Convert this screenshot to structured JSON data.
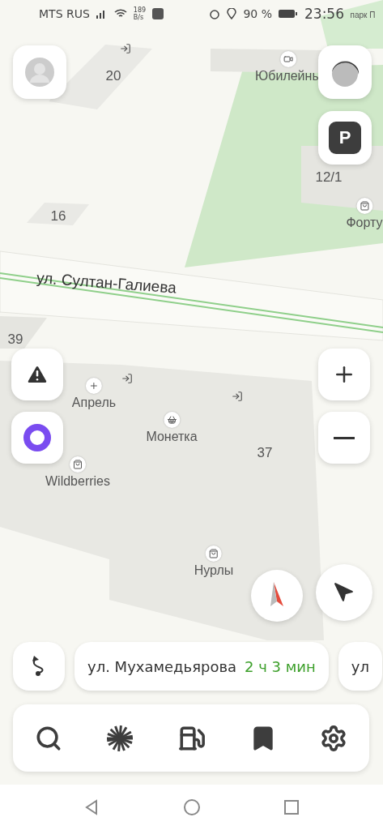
{
  "status_bar": {
    "carrier": "MTS RUS",
    "speed_value": "189",
    "speed_unit": "B/s",
    "battery": "90 %",
    "time": "23:56"
  },
  "map": {
    "street": "ул. Султан-Галиева",
    "labels": [
      {
        "kind": "number",
        "text": "20"
      },
      {
        "kind": "number",
        "text": "16"
      },
      {
        "kind": "number",
        "text": "12/1"
      },
      {
        "kind": "number",
        "text": "39"
      },
      {
        "kind": "number",
        "text": "37"
      },
      {
        "kind": "poi",
        "text": "Юбилейны"
      },
      {
        "kind": "poi",
        "text": "Форту"
      },
      {
        "kind": "poi",
        "text": "Апрель"
      },
      {
        "kind": "poi",
        "text": "Монетка"
      },
      {
        "kind": "poi",
        "text": "Wildberries"
      },
      {
        "kind": "poi",
        "text": "Нурлы"
      },
      {
        "kind": "small",
        "text": "парк П"
      }
    ]
  },
  "parking_button": {
    "label": "P"
  },
  "route_chips": [
    {
      "street": "ул. Мухамедьярова",
      "eta": "2 ч 3 мин"
    },
    {
      "street": "ул"
    }
  ]
}
